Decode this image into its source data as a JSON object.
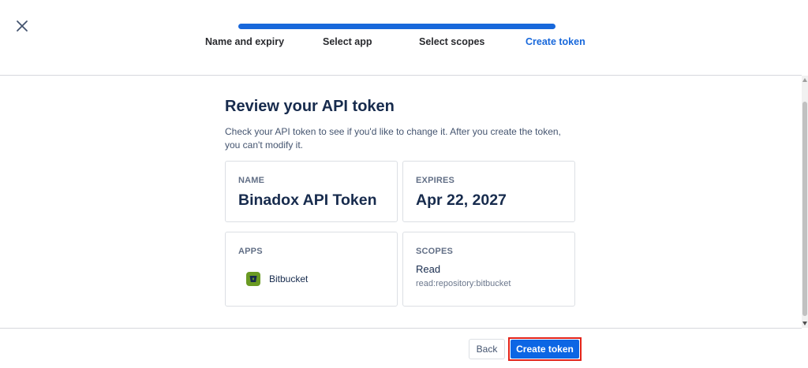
{
  "header": {
    "close_icon": "close-icon",
    "steps": [
      {
        "label": "Name and expiry",
        "active": false
      },
      {
        "label": "Select app",
        "active": false
      },
      {
        "label": "Select scopes",
        "active": false
      },
      {
        "label": "Create token",
        "active": true
      }
    ],
    "progress": 1.0
  },
  "main": {
    "title": "Review your API token",
    "description": "Check your API token to see if you'd like to change it. After you create the token, you can't modify it.",
    "name_card": {
      "label": "NAME",
      "value": "Binadox API Token"
    },
    "expires_card": {
      "label": "EXPIRES",
      "value": "Apr 22, 2027"
    },
    "apps_card": {
      "label": "APPS",
      "app_name": "Bitbucket",
      "app_icon": "bitbucket-icon"
    },
    "scopes_card": {
      "label": "SCOPES",
      "level": "Read",
      "scope": "read:repository:bitbucket"
    }
  },
  "footer": {
    "back_label": "Back",
    "create_label": "Create token"
  },
  "colors": {
    "accent": "#1868DB",
    "primary_button": "#0C66E4",
    "highlight_outline": "#E2231A",
    "bitbucket_green": "#6A9A23"
  }
}
